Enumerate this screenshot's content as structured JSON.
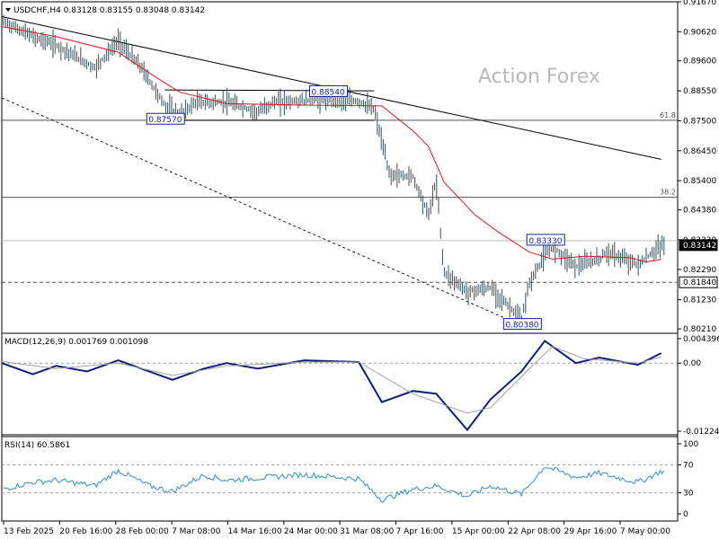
{
  "header": {
    "symbol_line": "USDCHF,H4  0.83128 0.83155 0.83048 0.83142",
    "watermark": "Action Forex"
  },
  "colors": {
    "background": "#ffffff",
    "price_bars": "#35505c",
    "ma_line": "#e0151d",
    "macd_line": "#0f1f80",
    "signal_line": "#a0a0a0",
    "rsi_line": "#2a8dd6",
    "label_border": "#10239c",
    "axis": "#000000"
  },
  "chart_data": [
    {
      "type": "ohlc",
      "title": "USDCHF,H4",
      "ohlc_last": {
        "open": 0.83128,
        "high": 0.83155,
        "low": 0.83048,
        "close": 0.83142
      },
      "y_ticks": [
        "0.91670",
        "0.90620",
        "0.89600",
        "0.88550",
        "0.87500",
        "0.86450",
        "0.85400",
        "0.84380",
        "0.83330",
        "0.82290",
        "0.81230",
        "0.80210"
      ],
      "ylim": [
        0.8021,
        0.9167
      ],
      "x_ticks": [
        "13 Feb 2025",
        "20 Feb 16:00",
        "28 Feb 00:00",
        "7 Mar 08:00",
        "14 Mar 16:00",
        "24 Mar 00:00",
        "31 Mar 08:00",
        "7 Apr 16:00",
        "15 Apr 00:00",
        "22 Apr 08:00",
        "29 Apr 16:00",
        "7 May 00:00"
      ],
      "price_path": [
        {
          "x": "13 Feb 2025",
          "y": 0.91
        },
        {
          "x": "17 Feb 2025",
          "y": 0.9045
        },
        {
          "x": "20 Feb 2025",
          "y": 0.9015
        },
        {
          "x": "25 Feb 2025",
          "y": 0.8935
        },
        {
          "x": "28 Feb 2025",
          "y": 0.903
        },
        {
          "x": "3 Mar 2025",
          "y": 0.8935
        },
        {
          "x": "6 Mar 2025",
          "y": 0.8805
        },
        {
          "x": "8 Mar 2025",
          "y": 0.877
        },
        {
          "x": "10 Mar 2025",
          "y": 0.8815
        },
        {
          "x": "14 Mar 2025",
          "y": 0.8815
        },
        {
          "x": "18 Mar 2025",
          "y": 0.878
        },
        {
          "x": "20 Mar 2025",
          "y": 0.8815
        },
        {
          "x": "27 Mar 2025",
          "y": 0.8825
        },
        {
          "x": "31 Mar 2025",
          "y": 0.8818
        },
        {
          "x": "2 Apr 2025",
          "y": 0.879
        },
        {
          "x": "4 Apr 2025",
          "y": 0.856
        },
        {
          "x": "7 Apr 2025",
          "y": 0.8555
        },
        {
          "x": "9 Apr 2025",
          "y": 0.842
        },
        {
          "x": "10 Apr 2025",
          "y": 0.854
        },
        {
          "x": "11 Apr 2025",
          "y": 0.822
        },
        {
          "x": "14 Apr 2025",
          "y": 0.815
        },
        {
          "x": "17 Apr 2025",
          "y": 0.8165
        },
        {
          "x": "21 Apr 2025",
          "y": 0.8055
        },
        {
          "x": "22 Apr 2025",
          "y": 0.818
        },
        {
          "x": "24 Apr 2025",
          "y": 0.828
        },
        {
          "x": "25 Apr 2025",
          "y": 0.831
        },
        {
          "x": "28 Apr 2025",
          "y": 0.824
        },
        {
          "x": "1 May 2025",
          "y": 0.8265
        },
        {
          "x": "2 May 2025",
          "y": 0.829
        },
        {
          "x": "6 May 2025",
          "y": 0.8245
        },
        {
          "x": "8 May 2025",
          "y": 0.829
        },
        {
          "x": "9 May 2025",
          "y": 0.8314
        }
      ],
      "moving_average": [
        {
          "x": "13 Feb 2025",
          "y": 0.908
        },
        {
          "x": "20 Feb 2025",
          "y": 0.9045
        },
        {
          "x": "28 Feb 2025",
          "y": 0.899
        },
        {
          "x": "5 Mar 2025",
          "y": 0.89
        },
        {
          "x": "8 Mar 2025",
          "y": 0.885
        },
        {
          "x": "14 Mar 2025",
          "y": 0.881
        },
        {
          "x": "24 Mar 2025",
          "y": 0.8805
        },
        {
          "x": "3 Apr 2025",
          "y": 0.8802
        },
        {
          "x": "7 Apr 2025",
          "y": 0.8715
        },
        {
          "x": "9 Apr 2025",
          "y": 0.866
        },
        {
          "x": "11 Apr 2025",
          "y": 0.8535
        },
        {
          "x": "15 Apr 2025",
          "y": 0.842
        },
        {
          "x": "18 Apr 2025",
          "y": 0.836
        },
        {
          "x": "22 Apr 2025",
          "y": 0.829
        },
        {
          "x": "25 Apr 2025",
          "y": 0.8265
        },
        {
          "x": "29 Apr 2025",
          "y": 0.8275
        },
        {
          "x": "5 May 2025",
          "y": 0.827
        },
        {
          "x": "7 May 2025",
          "y": 0.8255
        },
        {
          "x": "9 May 2025",
          "y": 0.8265
        }
      ],
      "levels": [
        {
          "label": "61.8",
          "price": 0.8752
        },
        {
          "label": "38.2",
          "price": 0.8482
        },
        {
          "label": "",
          "price": 0.833
        },
        {
          "label": "",
          "price": 0.8184
        }
      ],
      "trendlines": [
        {
          "style": "solid",
          "from": {
            "x": "13 Feb 2025",
            "y": 0.9115
          },
          "to": {
            "x": "9 May 2025",
            "y": 0.8615
          }
        },
        {
          "style": "dashed",
          "from": {
            "x": "13 Feb 2025",
            "y": 0.883
          },
          "to": {
            "x": "20 Apr 2025",
            "y": 0.8045
          }
        },
        {
          "style": "solid",
          "from": {
            "x": "6 Mar 2025",
            "y": 0.8752
          },
          "to": {
            "x": "2 Apr 2025",
            "y": 0.8752
          }
        },
        {
          "style": "solid",
          "from": {
            "x": "6 Mar 2025",
            "y": 0.8858
          },
          "to": {
            "x": "2 Apr 2025",
            "y": 0.8855
          }
        }
      ],
      "annotations": [
        {
          "text": "0.88540",
          "x": "27 Mar 2025",
          "y": 0.8854
        },
        {
          "text": "0.87570",
          "x": "6 Mar 2025",
          "y": 0.8757
        },
        {
          "text": "0.83330",
          "x": "24 Apr 2025",
          "y": 0.8333
        },
        {
          "text": "0.80380",
          "x": "21 Apr 2025",
          "y": 0.8038
        }
      ],
      "current_price_label": "0.83142",
      "level_labels": [
        "0.83142",
        "0.81840"
      ]
    },
    {
      "type": "line",
      "title": "MACD(12,26,9) 0.001769 0.001098",
      "y_ticks": [
        "0.004396",
        "0.00",
        "-0.012241"
      ],
      "ylim": [
        -0.01224,
        0.0044
      ],
      "series": [
        {
          "name": "MACD",
          "values": [
            {
              "x": "13 Feb 2025",
              "y": 0.0
            },
            {
              "x": "17 Feb 2025",
              "y": -0.002
            },
            {
              "x": "20 Feb 2025",
              "y": -0.0005
            },
            {
              "x": "24 Feb 2025",
              "y": -0.0015
            },
            {
              "x": "28 Feb 2025",
              "y": 0.0005
            },
            {
              "x": "3 Mar 2025",
              "y": -0.001
            },
            {
              "x": "7 Mar 2025",
              "y": -0.003
            },
            {
              "x": "11 Mar 2025",
              "y": -0.001
            },
            {
              "x": "14 Mar 2025",
              "y": 0.0
            },
            {
              "x": "18 Mar 2025",
              "y": -0.001
            },
            {
              "x": "24 Mar 2025",
              "y": 0.0005
            },
            {
              "x": "31 Mar 2025",
              "y": 0.0002
            },
            {
              "x": "3 Apr 2025",
              "y": -0.007
            },
            {
              "x": "7 Apr 2025",
              "y": -0.005
            },
            {
              "x": "10 Apr 2025",
              "y": -0.0055
            },
            {
              "x": "14 Apr 2025",
              "y": -0.012
            },
            {
              "x": "17 Apr 2025",
              "y": -0.0065
            },
            {
              "x": "21 Apr 2025",
              "y": -0.0015
            },
            {
              "x": "24 Apr 2025",
              "y": 0.004
            },
            {
              "x": "28 Apr 2025",
              "y": 0.0
            },
            {
              "x": "1 May 2025",
              "y": 0.001
            },
            {
              "x": "6 May 2025",
              "y": -0.0003
            },
            {
              "x": "9 May 2025",
              "y": 0.0018
            }
          ]
        },
        {
          "name": "Signal",
          "values": [
            {
              "x": "13 Feb 2025",
              "y": 0.0003
            },
            {
              "x": "20 Feb 2025",
              "y": -0.001
            },
            {
              "x": "28 Feb 2025",
              "y": 0.0
            },
            {
              "x": "7 Mar 2025",
              "y": -0.0022
            },
            {
              "x": "14 Mar 2025",
              "y": -0.0005
            },
            {
              "x": "24 Mar 2025",
              "y": 0.0002
            },
            {
              "x": "31 Mar 2025",
              "y": 0.0002
            },
            {
              "x": "7 Apr 2025",
              "y": -0.0055
            },
            {
              "x": "14 Apr 2025",
              "y": -0.009
            },
            {
              "x": "17 Apr 2025",
              "y": -0.008
            },
            {
              "x": "22 Apr 2025",
              "y": -0.001
            },
            {
              "x": "25 Apr 2025",
              "y": 0.003
            },
            {
              "x": "29 Apr 2025",
              "y": 0.0008
            },
            {
              "x": "6 May 2025",
              "y": 0.0
            },
            {
              "x": "9 May 2025",
              "y": 0.0011
            }
          ]
        }
      ]
    },
    {
      "type": "line",
      "title": "RSI(14) 60.5861",
      "y_ticks": [
        "100",
        "70",
        "30",
        "0"
      ],
      "ylim": [
        0,
        100
      ],
      "series": [
        {
          "name": "RSI",
          "values": [
            {
              "x": "13 Feb 2025",
              "y": 35
            },
            {
              "x": "17 Feb 2025",
              "y": 45
            },
            {
              "x": "20 Feb 2025",
              "y": 48
            },
            {
              "x": "25 Feb 2025",
              "y": 40
            },
            {
              "x": "28 Feb 2025",
              "y": 62
            },
            {
              "x": "4 Mar 2025",
              "y": 40
            },
            {
              "x": "7 Mar 2025",
              "y": 32
            },
            {
              "x": "11 Mar 2025",
              "y": 55
            },
            {
              "x": "14 Mar 2025",
              "y": 48
            },
            {
              "x": "19 Mar 2025",
              "y": 52
            },
            {
              "x": "24 Mar 2025",
              "y": 56
            },
            {
              "x": "31 Mar 2025",
              "y": 50
            },
            {
              "x": "3 Apr 2025",
              "y": 20
            },
            {
              "x": "7 Apr 2025",
              "y": 35
            },
            {
              "x": "10 Apr 2025",
              "y": 40
            },
            {
              "x": "14 Apr 2025",
              "y": 25
            },
            {
              "x": "17 Apr 2025",
              "y": 40
            },
            {
              "x": "21 Apr 2025",
              "y": 28
            },
            {
              "x": "24 Apr 2025",
              "y": 68
            },
            {
              "x": "28 Apr 2025",
              "y": 52
            },
            {
              "x": "1 May 2025",
              "y": 58
            },
            {
              "x": "6 May 2025",
              "y": 45
            },
            {
              "x": "9 May 2025",
              "y": 60.5861
            }
          ]
        }
      ]
    }
  ]
}
